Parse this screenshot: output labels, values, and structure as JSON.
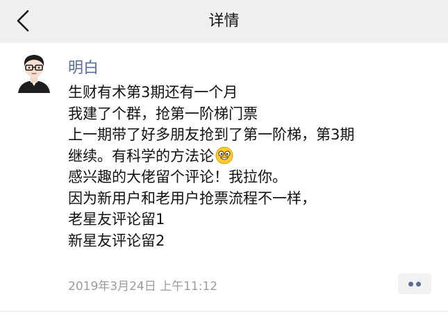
{
  "nav": {
    "title": "详情",
    "back_icon": "chevron-left-icon"
  },
  "post": {
    "author": "明白",
    "avatar_icon": "cartoon-avatar-with-glasses",
    "content_lines": [
      "生财有术第3期还有一个月",
      "我建了个群，抢第一阶梯门票",
      "上一期带了好多朋友抢到了第一阶梯，第3期",
      "继续。有科学的方法论",
      "感兴趣的大佬留个评论！我拉你。",
      "因为新用户和老用户抢票流程不一样，",
      "老星友评论留1",
      "新星友评论留2"
    ],
    "inline_emoji": "grinning-face-with-glasses-emoji",
    "timestamp": "2019年3月24日 上午11:12",
    "more_icon": "more-dots-icon"
  },
  "colors": {
    "nav_background": "#efefef",
    "author_link": "#576b95",
    "timestamp": "#9b9b9b",
    "text": "#111111"
  }
}
